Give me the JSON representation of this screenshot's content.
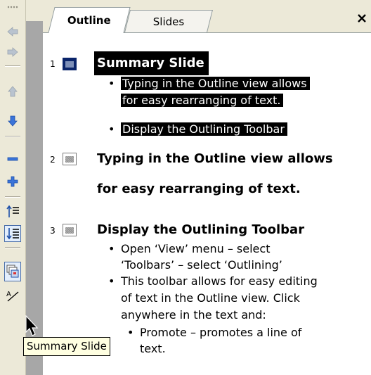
{
  "tabs": [
    {
      "label": "Outline",
      "active": true
    },
    {
      "label": "Slides",
      "active": false
    }
  ],
  "close_label": "×",
  "toolbar": {
    "buttons": [
      "promote-left-icon",
      "demote-right-icon",
      "move-up-icon",
      "move-down-icon",
      "collapse-icon",
      "expand-icon",
      "collapse-all-icon",
      "expand-all-icon",
      "summary-slide-icon",
      "show-formatting-icon"
    ]
  },
  "slides": [
    {
      "number": "1",
      "title": "Summary Slide",
      "selected": true,
      "bullets": [
        {
          "lines": [
            "Typing in the Outline view allows",
            "for easy rearranging of text."
          ]
        },
        {
          "lines": [
            "Display the Outlining Toolbar"
          ]
        }
      ]
    },
    {
      "number": "2",
      "title_lines": [
        "Typing in the Outline view allows",
        "for easy rearranging of text."
      ]
    },
    {
      "number": "3",
      "title": "Display the Outlining Toolbar",
      "bullets": [
        {
          "lines": [
            "Open ‘View’ menu – select",
            "‘Toolbars’ – select ‘Outlining’"
          ]
        },
        {
          "lines": [
            "This toolbar allows for easy editing",
            "of text in the Outline view.  Click",
            "anywhere in the text and:"
          ]
        }
      ],
      "sub_bullets": [
        {
          "lines": [
            "Promote – promotes a line of",
            "text."
          ]
        }
      ]
    }
  ],
  "tooltip": "Summary Slide",
  "colors": {
    "selection": "#000000",
    "selected_icon": "#0a246a",
    "tooltip_bg": "#ffffe1"
  }
}
